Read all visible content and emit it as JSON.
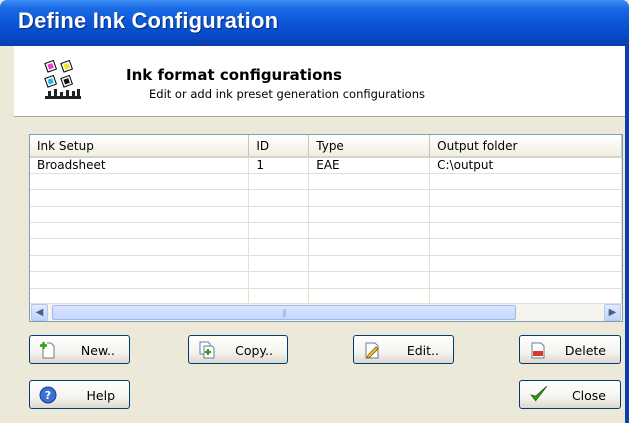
{
  "window": {
    "title": "Define Ink Configuration"
  },
  "header": {
    "icon": "ink-config-icon",
    "title": "Ink format configurations",
    "subtitle": "Edit or add ink preset generation configurations"
  },
  "grid": {
    "columns": [
      "Ink Setup",
      "ID",
      "Type",
      "Output folder"
    ],
    "rows": [
      [
        "Broadsheet",
        "1",
        "EAE",
        "C:\\output"
      ]
    ],
    "scrollbar": {
      "left_icon": "scroll-left-arrow-icon",
      "right_icon": "scroll-right-arrow-icon"
    }
  },
  "buttons": {
    "new_label": "New..",
    "copy_label": "Copy..",
    "edit_label": "Edit..",
    "delete_label": "Delete",
    "help_label": "Help",
    "close_label": "Close"
  },
  "colors": {
    "titlebar": "#0a57d6",
    "accent_green": "#2e9e1a",
    "help_blue": "#3b6fd4"
  }
}
